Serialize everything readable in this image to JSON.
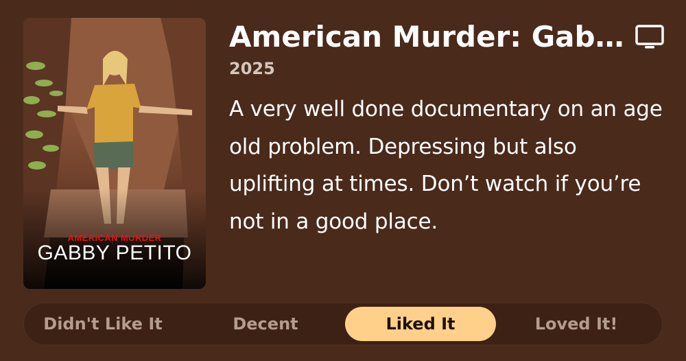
{
  "poster": {
    "series_title": "AMERICAN MURDER",
    "subject_name": "GABBY PETITO"
  },
  "details": {
    "title": "American Murder: Gabby Petito",
    "year": "2025",
    "review": "A very well done documentary on an age old problem. Depressing but also uplifting at times. Don’t watch if you’re not in a good place.",
    "media_type_icon": "tv-icon"
  },
  "rating": {
    "options": [
      {
        "label": "Didn't Like It",
        "selected": false
      },
      {
        "label": "Decent",
        "selected": false
      },
      {
        "label": "Liked It",
        "selected": true
      },
      {
        "label": "Loved It!",
        "selected": false
      }
    ]
  },
  "colors": {
    "background": "#4a2a1b",
    "selected_pill": "#ffd08a",
    "muted_text": "#b49c90",
    "year_text": "#d6c6bd"
  }
}
